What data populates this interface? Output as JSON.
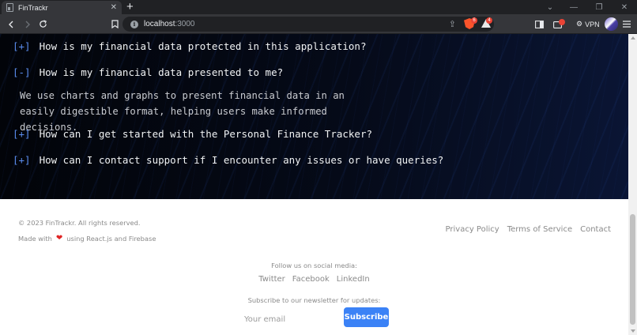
{
  "browser": {
    "tab_title": "FinTrackr",
    "url_host": "localhost",
    "url_port": ":3000",
    "vpn_label": "VPN",
    "shield_badge": "6",
    "rewards_badge": "4"
  },
  "faq": {
    "items": [
      {
        "toggle": "[+]",
        "question": "How is my financial data protected in this application?"
      },
      {
        "toggle": "[-]",
        "question": "How is my financial data presented to me?"
      },
      {
        "toggle": "[+]",
        "question": "How can I get started with the Personal Finance Tracker?"
      },
      {
        "toggle": "[+]",
        "question": "How can I contact support if I encounter any issues or have queries?"
      }
    ],
    "answer": "We use charts and graphs to present financial data in an easily digestible format, helping users make informed decisions."
  },
  "footer": {
    "copyright": "© 2023 FinTrackr. All rights reserved.",
    "made_with_prefix": "Made with",
    "made_with_suffix": "using React.js and Firebase",
    "links": [
      "Privacy Policy",
      "Terms of Service",
      "Contact"
    ],
    "follow_text": "Follow us on social media:",
    "socials": [
      "Twitter",
      "Facebook",
      "LinkedIn"
    ],
    "newsletter_text": "Subscribe to our newsletter for updates:",
    "email_placeholder": "Your email",
    "email_value": "",
    "subscribe_label": "Subscribe"
  },
  "colors": {
    "accent": "#3b82f6",
    "faq_toggle": "#5b8def",
    "heart": "#e02424",
    "footer_text": "#8a8a8a"
  },
  "icons": [
    "back-icon",
    "forward-icon",
    "reload-icon",
    "bookmark-icon",
    "site-info-icon",
    "share-icon",
    "brave-shields-icon",
    "brave-rewards-icon",
    "sidebar-icon",
    "wallet-icon",
    "vpn-icon",
    "profile-avatar",
    "menu-icon",
    "heart-icon"
  ]
}
